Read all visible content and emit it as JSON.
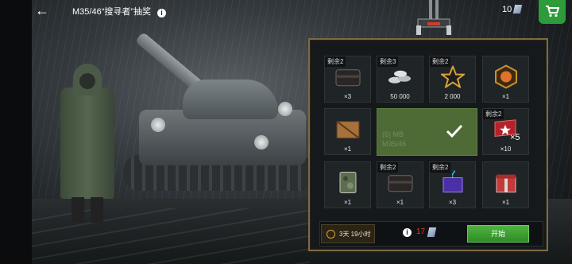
{
  "header": {
    "title": "M35/46“搜寻者”抽奖",
    "info_icon": "info-icon",
    "currency_amount": "10",
    "currency_icon": "gold-bar-icon",
    "shop_icon": "shopping-cart-icon"
  },
  "grid": {
    "cells": [
      {
        "tag": "剩余2",
        "qty": "×3",
        "icon": "dark-container-icon"
      },
      {
        "tag": "剩余3",
        "qty": "50 000",
        "icon": "silver-coins-icon"
      },
      {
        "tag": "剩余2",
        "qty": "2 000",
        "icon": "gold-star-icon"
      },
      {
        "tag": "",
        "qty": "×1",
        "icon": "orange-consumable-icon"
      },
      {
        "tag": "",
        "qty": "×1",
        "icon": "wooden-crate-icon"
      },
      {
        "tag": "剩余2",
        "qty": "×10",
        "icon": "red-star-flag-icon",
        "overlay": "×5"
      },
      {
        "tag": "",
        "qty": "×1",
        "icon": "camo-card-icon"
      },
      {
        "tag": "剩余2",
        "qty": "×1",
        "icon": "dark-container-icon"
      },
      {
        "tag": "剩余2",
        "qty": "×3",
        "icon": "mystery-box-icon"
      },
      {
        "tag": "",
        "qty": "×1",
        "icon": "red-gift-box-icon"
      }
    ],
    "prize": {
      "ghost_line1": "(6) MB",
      "ghost_line2": "M35/46",
      "icon": "checkmark-icon"
    }
  },
  "footer": {
    "timer": "3天 19小时",
    "cost": "17",
    "start_label": "开始"
  },
  "colors": {
    "panel_border": "#7d6a43",
    "start_green": "#3ea332",
    "cost_red": "#e23b2e",
    "prize_green": "#4e6a35"
  }
}
